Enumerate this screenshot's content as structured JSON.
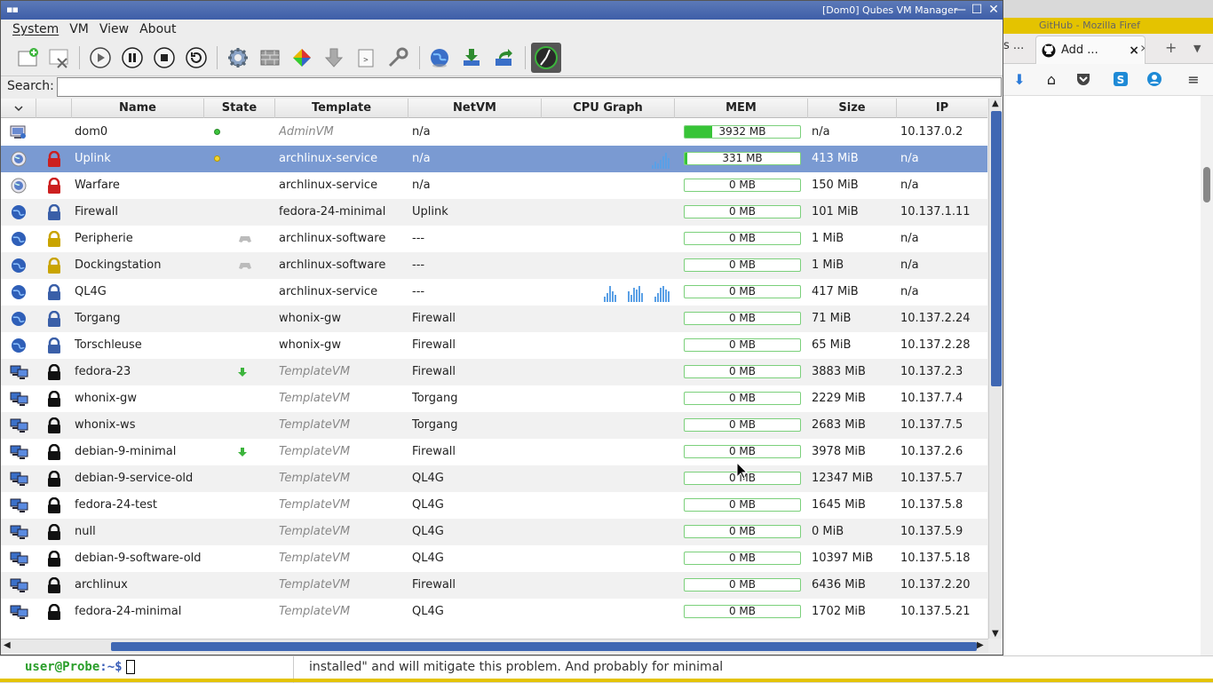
{
  "firefox": {
    "title": "GitHub - Mozilla Firef",
    "prev_tab": "s ...",
    "tab_label": "Add ..."
  },
  "terminal": {
    "user": "user@Probe",
    "path": ":~$"
  },
  "background_text": "installed\" and will mitigate this problem. And probably for minimal",
  "window": {
    "title": "[Dom0] Qubes VM Manager"
  },
  "menu": [
    "System",
    "VM",
    "View",
    "About"
  ],
  "search": {
    "label": "Search:",
    "value": ""
  },
  "columns": [
    "Name",
    "State",
    "Template",
    "NetVM",
    "CPU Graph",
    "MEM",
    "Size",
    "IP"
  ],
  "rows": [
    {
      "name": "dom0",
      "state": "green",
      "template": "AdminVM",
      "template_vm": true,
      "netvm": "n/a",
      "mem": "3932 MB",
      "mem_fill": 0.24,
      "size": "n/a",
      "ip": "10.137.0.2",
      "icon": "adminvm-icon",
      "lock": "none",
      "cpu": []
    },
    {
      "name": "Uplink",
      "state": "yellow",
      "template": "archlinux-service",
      "template_vm": false,
      "netvm": "n/a",
      "mem": "331 MB",
      "mem_fill": 0.02,
      "size": "413 MiB",
      "ip": "n/a",
      "icon": "netvm-icon",
      "lock": "red",
      "cpu": [
        2,
        4,
        3,
        5,
        7,
        9,
        6
      ],
      "selected": true
    },
    {
      "name": "Warfare",
      "state": "",
      "template": "archlinux-service",
      "template_vm": false,
      "netvm": "n/a",
      "mem": "0 MB",
      "mem_fill": 0,
      "size": "150 MiB",
      "ip": "n/a",
      "icon": "netvm-icon",
      "lock": "red",
      "cpu": []
    },
    {
      "name": "Firewall",
      "state": "",
      "template": "fedora-24-minimal",
      "template_vm": false,
      "netvm": "Uplink",
      "mem": "0 MB",
      "mem_fill": 0,
      "size": "101 MiB",
      "ip": "10.137.1.11",
      "icon": "globe-icon",
      "lock": "blue",
      "cpu": []
    },
    {
      "name": "Peripherie",
      "state": "gamepad",
      "template": "archlinux-software",
      "template_vm": false,
      "netvm": "---",
      "mem": "0 MB",
      "mem_fill": 0,
      "size": "1 MiB",
      "ip": "n/a",
      "icon": "globe-icon",
      "lock": "yellow",
      "cpu": []
    },
    {
      "name": "Dockingstation",
      "state": "gamepad",
      "template": "archlinux-software",
      "template_vm": false,
      "netvm": "---",
      "mem": "0 MB",
      "mem_fill": 0,
      "size": "1 MiB",
      "ip": "n/a",
      "icon": "globe-icon",
      "lock": "yellow",
      "cpu": []
    },
    {
      "name": "QL4G",
      "state": "",
      "template": "archlinux-service",
      "template_vm": false,
      "netvm": "---",
      "mem": "0 MB",
      "mem_fill": 0,
      "size": "417 MiB",
      "ip": "n/a",
      "icon": "globe-icon",
      "lock": "blue",
      "cpu": [
        3,
        5,
        9,
        6,
        4,
        0,
        0,
        0,
        0,
        6,
        4,
        8,
        7,
        9,
        5,
        0,
        0,
        0,
        0,
        3,
        5,
        8,
        9,
        7,
        6
      ]
    },
    {
      "name": "Torgang",
      "state": "",
      "template": "whonix-gw",
      "template_vm": false,
      "netvm": "Firewall",
      "mem": "0 MB",
      "mem_fill": 0,
      "size": "71 MiB",
      "ip": "10.137.2.24",
      "icon": "globe-icon",
      "lock": "blue",
      "cpu": []
    },
    {
      "name": "Torschleuse",
      "state": "",
      "template": "whonix-gw",
      "template_vm": false,
      "netvm": "Firewall",
      "mem": "0 MB",
      "mem_fill": 0,
      "size": "65 MiB",
      "ip": "10.137.2.28",
      "icon": "globe-icon",
      "lock": "blue",
      "cpu": []
    },
    {
      "name": "fedora-23",
      "state": "update",
      "template": "TemplateVM",
      "template_vm": true,
      "netvm": "Firewall",
      "mem": "0 MB",
      "mem_fill": 0,
      "size": "3883 MiB",
      "ip": "10.137.2.3",
      "icon": "templatevm-icon",
      "lock": "black",
      "cpu": []
    },
    {
      "name": "whonix-gw",
      "state": "",
      "template": "TemplateVM",
      "template_vm": true,
      "netvm": "Torgang",
      "mem": "0 MB",
      "mem_fill": 0,
      "size": "2229 MiB",
      "ip": "10.137.7.4",
      "icon": "templatevm-icon",
      "lock": "black",
      "cpu": []
    },
    {
      "name": "whonix-ws",
      "state": "",
      "template": "TemplateVM",
      "template_vm": true,
      "netvm": "Torgang",
      "mem": "0 MB",
      "mem_fill": 0,
      "size": "2683 MiB",
      "ip": "10.137.7.5",
      "icon": "templatevm-icon",
      "lock": "black",
      "cpu": []
    },
    {
      "name": "debian-9-minimal",
      "state": "update",
      "template": "TemplateVM",
      "template_vm": true,
      "netvm": "Firewall",
      "mem": "0 MB",
      "mem_fill": 0,
      "size": "3978 MiB",
      "ip": "10.137.2.6",
      "icon": "templatevm-icon",
      "lock": "black",
      "cpu": []
    },
    {
      "name": "debian-9-service-old",
      "state": "",
      "template": "TemplateVM",
      "template_vm": true,
      "netvm": "QL4G",
      "mem": "0 MB",
      "mem_fill": 0,
      "size": "12347 MiB",
      "ip": "10.137.5.7",
      "icon": "templatevm-icon",
      "lock": "black",
      "cpu": []
    },
    {
      "name": "fedora-24-test",
      "state": "",
      "template": "TemplateVM",
      "template_vm": true,
      "netvm": "QL4G",
      "mem": "0 MB",
      "mem_fill": 0,
      "size": "1645 MiB",
      "ip": "10.137.5.8",
      "icon": "templatevm-icon",
      "lock": "black",
      "cpu": []
    },
    {
      "name": "null",
      "state": "",
      "template": "TemplateVM",
      "template_vm": true,
      "netvm": "QL4G",
      "mem": "0 MB",
      "mem_fill": 0,
      "size": "0 MiB",
      "ip": "10.137.5.9",
      "icon": "templatevm-icon",
      "lock": "black",
      "cpu": []
    },
    {
      "name": "debian-9-software-old",
      "state": "",
      "template": "TemplateVM",
      "template_vm": true,
      "netvm": "QL4G",
      "mem": "0 MB",
      "mem_fill": 0,
      "size": "10397 MiB",
      "ip": "10.137.5.18",
      "icon": "templatevm-icon",
      "lock": "black",
      "cpu": []
    },
    {
      "name": "archlinux",
      "state": "",
      "template": "TemplateVM",
      "template_vm": true,
      "netvm": "Firewall",
      "mem": "0 MB",
      "mem_fill": 0,
      "size": "6436 MiB",
      "ip": "10.137.2.20",
      "icon": "templatevm-icon",
      "lock": "black",
      "cpu": []
    },
    {
      "name": "fedora-24-minimal",
      "state": "",
      "template": "TemplateVM",
      "template_vm": true,
      "netvm": "QL4G",
      "mem": "0 MB",
      "mem_fill": 0,
      "size": "1702 MiB",
      "ip": "10.137.5.21",
      "icon": "templatevm-icon",
      "lock": "black",
      "cpu": []
    }
  ],
  "colors": {
    "selection": "#7a9ad2",
    "titlebar": "#3e5ea8",
    "mem_bar": "#37c437",
    "lock_red": "#cc1f1f",
    "lock_yellow": "#c9a400",
    "lock_blue": "#3a5fa8",
    "lock_black": "#111111",
    "cpu_graph": "#5aa0e6"
  }
}
